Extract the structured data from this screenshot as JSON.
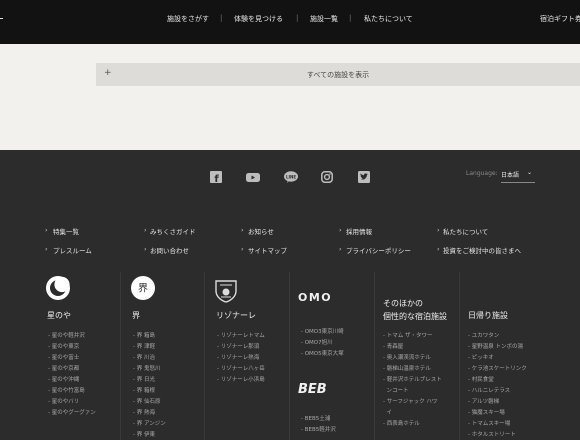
{
  "header": {
    "nav": [
      "施設をさがす",
      "体験を見つける",
      "施設一覧",
      "私たちについて"
    ],
    "separator": "|",
    "right_label": "宿泊ギフト券"
  },
  "main": {
    "show_all_label": "すべての施設を表示",
    "plus_icon": "+"
  },
  "footer": {
    "social": [
      "facebook-icon",
      "youtube-icon",
      "line-icon",
      "instagram-icon",
      "twitter-icon"
    ],
    "social_glyphs": {
      "facebook": "f",
      "line": "LINE"
    },
    "language_label": "Language:",
    "language_value": "日本語",
    "language_caret": "⌄",
    "link_bullet": "›",
    "links_row1": [
      "特集一覧",
      "みちくさガイド",
      "お知らせ",
      "採用情報",
      "私たちについて"
    ],
    "links_row2": [
      "プレスルーム",
      "お問い合わせ",
      "サイトマップ",
      "プライバシーポリシー",
      "投資をご検討中の皆さまへ"
    ],
    "brands": [
      {
        "title": "星のや",
        "logo": "",
        "items": [
          "- 星のや軽井沢",
          "- 星のや東京",
          "- 星のや富士",
          "- 星のや京都",
          "- 星のや沖縄",
          "- 星のや竹富島",
          "- 星のやバリ",
          "- 星のやグーグァン"
        ]
      },
      {
        "title": "界",
        "logo": "界",
        "items": [
          "- 界 箱島",
          "- 界 津軽",
          "- 界 川治",
          "- 界 鬼怒川",
          "- 界 日光",
          "- 界 箱根",
          "- 界 仙石原",
          "- 界 熱海",
          "- 界 アンジン",
          "- 界 伊東"
        ]
      },
      {
        "title": "リゾナーレ",
        "logo": "",
        "items": [
          "- リゾナーレトマム",
          "- リゾナーレ那須",
          "- リゾナーレ熱海",
          "- リゾナーレ八ヶ岳",
          "- リゾナーレ小浜島"
        ]
      },
      {
        "title": "",
        "logo": "OMO",
        "items": [
          "- OMO3東京川崎",
          "- OMO7旭川",
          "- OMO5東京大塚"
        ],
        "logo2": "BEB",
        "items2": [
          "- BEB5土浦",
          "- BEB5軽井沢"
        ]
      },
      {
        "title": "そのほかの\n個性的な宿泊施設",
        "logo": "",
        "items": [
          "- トマム ザ・タワー",
          "- 青森屋",
          "- 奥入瀬渓流ホテル",
          "- 磐梯山温泉ホテル",
          "- 軽井沢ホテルブレスト",
          "  ンコート",
          "- サーフジャック ハワ",
          "  イ",
          "- 西表島ホテル"
        ]
      },
      {
        "title": "日帰り施設",
        "logo": "",
        "items": [
          "- ユカワタン",
          "- 星野温泉 トンボの湯",
          "- ピッキオ",
          "- ケラ池スケートリンク",
          "- 村民食堂",
          "- ハルニレテラス",
          "- アルツ磐梯",
          "- 猫魔スキー場",
          "- トマムスキー場",
          "- ホタルストリート"
        ]
      }
    ]
  }
}
